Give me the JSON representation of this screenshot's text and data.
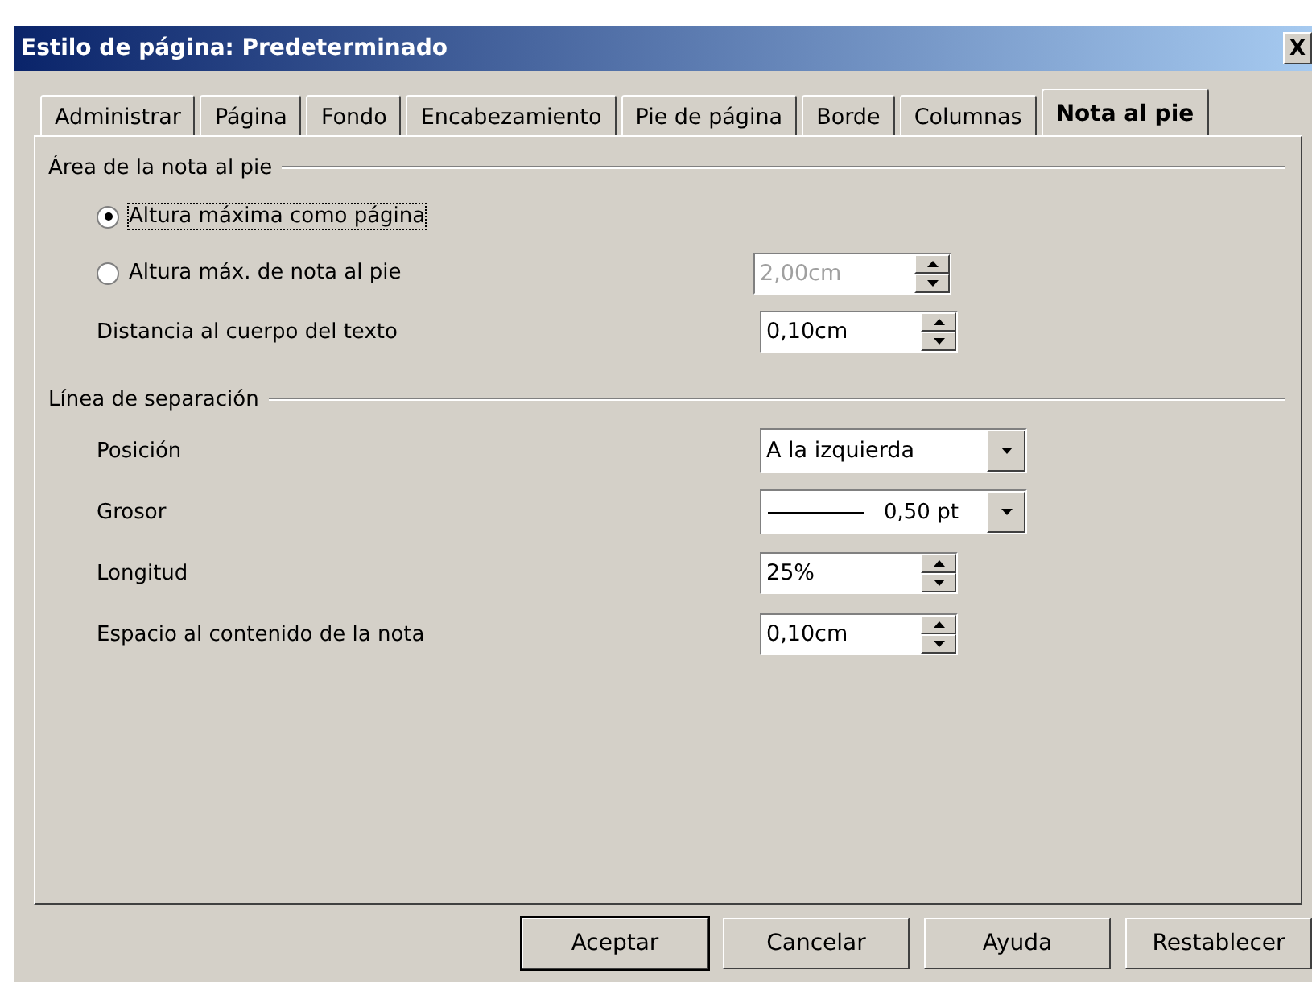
{
  "window": {
    "title": "Estilo de página: Predeterminado",
    "close": "X"
  },
  "tabs": [
    {
      "label": "Administrar",
      "selected": false
    },
    {
      "label": "Página",
      "selected": false
    },
    {
      "label": "Fondo",
      "selected": false
    },
    {
      "label": "Encabezamiento",
      "selected": false
    },
    {
      "label": "Pie de página",
      "selected": false
    },
    {
      "label": "Borde",
      "selected": false
    },
    {
      "label": "Columnas",
      "selected": false
    },
    {
      "label": "Nota al pie",
      "selected": true
    }
  ],
  "sections": [
    {
      "title": "Área de la nota al pie",
      "rows": [
        {
          "kind": "radio",
          "label": "Altura máxima como página",
          "selected": true,
          "focused": true
        },
        {
          "kind": "radio",
          "label": "Altura máx. de nota al pie",
          "selected": false,
          "focused": false,
          "control": {
            "kind": "spin",
            "value": "2,00cm",
            "disabled": true
          }
        },
        {
          "kind": "label",
          "label": "Distancia al cuerpo del texto",
          "control": {
            "kind": "spin",
            "value": "0,10cm",
            "disabled": false
          }
        }
      ]
    },
    {
      "title": "Línea de separación",
      "rows": [
        {
          "kind": "label",
          "label": "Posición",
          "control": {
            "kind": "dropdown",
            "value": "A la izquierda"
          }
        },
        {
          "kind": "label",
          "label": "Grosor",
          "control": {
            "kind": "line-dropdown",
            "value": "0,50 pt"
          }
        },
        {
          "kind": "label",
          "label": "Longitud",
          "control": {
            "kind": "spin",
            "value": "25%",
            "disabled": false
          }
        },
        {
          "kind": "label",
          "label": "Espacio al contenido de la nota",
          "control": {
            "kind": "spin",
            "value": "0,10cm",
            "disabled": false
          }
        }
      ]
    }
  ],
  "buttons": [
    {
      "label": "Aceptar",
      "default": true
    },
    {
      "label": "Cancelar",
      "default": false
    },
    {
      "label": "Ayuda",
      "default": false
    },
    {
      "label": "Restablecer",
      "default": false
    }
  ]
}
